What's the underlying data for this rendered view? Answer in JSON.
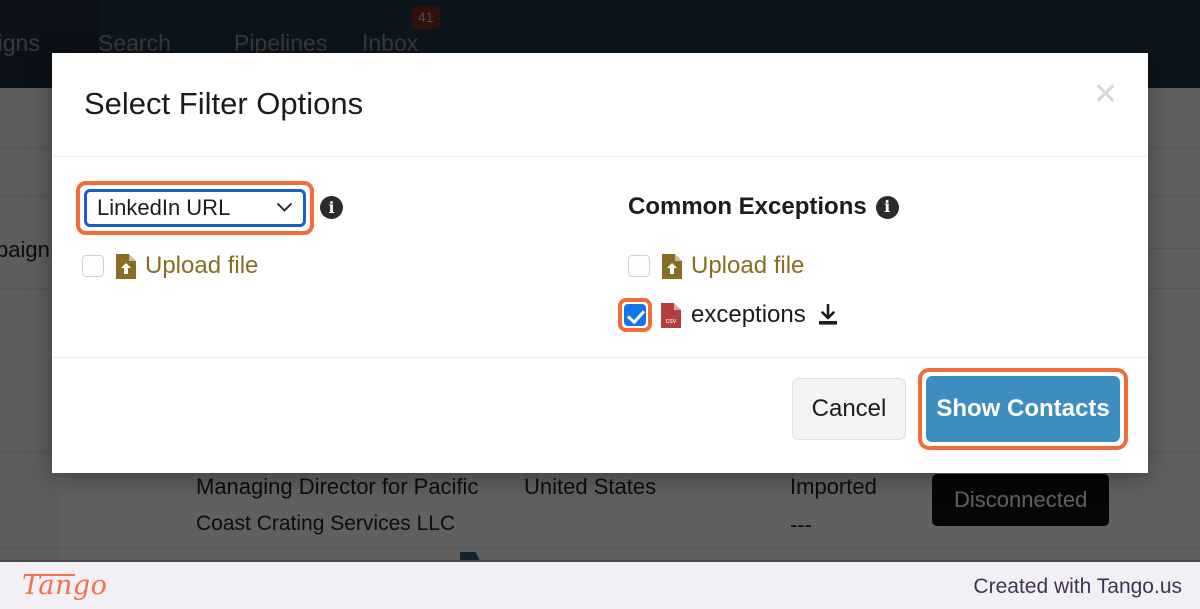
{
  "navbar": {
    "items": [
      {
        "label": "paigns",
        "name": "nav-item-campaigns"
      },
      {
        "label": "Search",
        "name": "nav-item-search"
      },
      {
        "label": "Pipelines",
        "name": "nav-item-pipelines"
      },
      {
        "label": "Inbox",
        "name": "nav-item-inbox"
      }
    ],
    "inbox_badge": "41",
    "bg_color": "#24394b",
    "badge_color": "#7e2a24"
  },
  "background": {
    "sidebar_label": "paign",
    "table": {
      "title_line1": "Managing Director for Pacific",
      "title_line2": "Coast Crating Services LLC",
      "country": "United States",
      "source": "Imported",
      "source_sub": "---",
      "status_badge": "Disconnected"
    }
  },
  "modal": {
    "title": "Select Filter Options",
    "close_label": "✕",
    "left": {
      "select": {
        "value": "LinkedIn URL",
        "options": [
          "LinkedIn URL"
        ],
        "highlight_color": "#f26c37",
        "focus_color": "#1a5fd0"
      },
      "info_icon_label": "i",
      "upload_row": {
        "label": "Upload file",
        "checked": false,
        "label_color": "#8a6d24"
      }
    },
    "right": {
      "heading": "Common Exceptions",
      "info_icon_label": "i",
      "upload_row": {
        "label": "Upload file",
        "checked": false,
        "label_color": "#8a6d24"
      },
      "exceptions_row": {
        "label": "exceptions",
        "file_type": "CSV",
        "checked": true,
        "highlight_color": "#f26c37"
      }
    },
    "footer": {
      "cancel_label": "Cancel",
      "primary_label": "Show Contacts",
      "primary_color": "#3d8dbe",
      "primary_highlight": "#f26c37"
    }
  },
  "tango_footer": {
    "logo": "Tango",
    "credit": "Created with Tango.us"
  }
}
